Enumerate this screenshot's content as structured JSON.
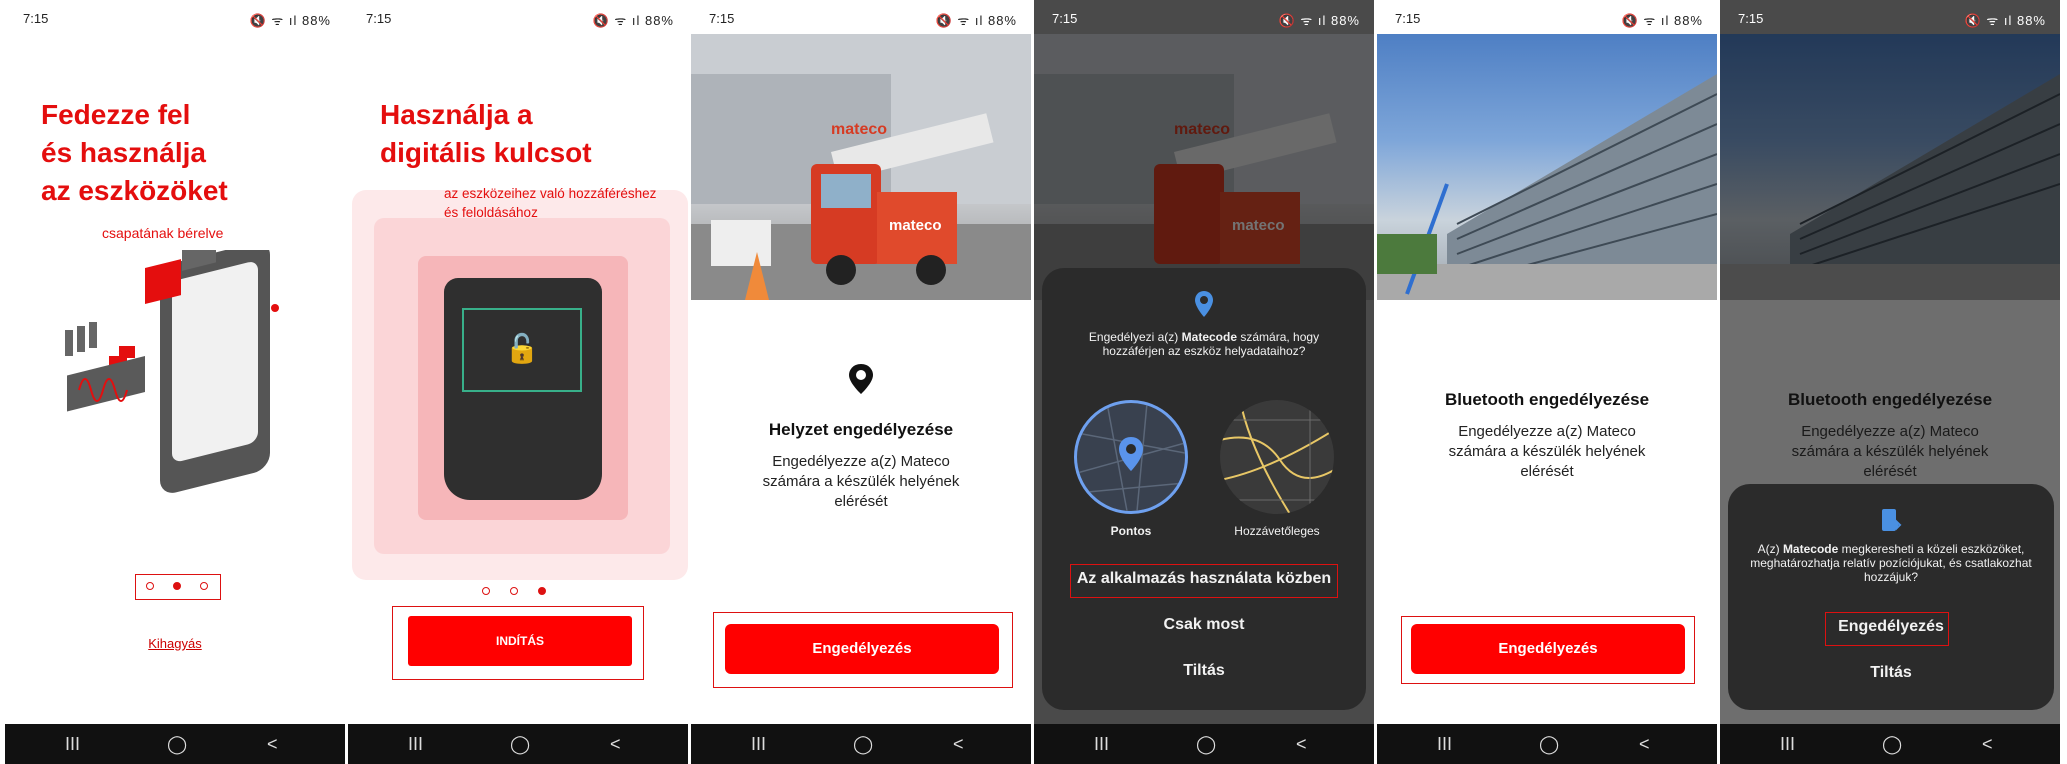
{
  "status_bar": {
    "time": "7:15",
    "icons_text": "🔇 ᯤ ıl 88%"
  },
  "nav_bar": {
    "recent": "III",
    "home": "◯",
    "back": "<"
  },
  "screen1": {
    "heading": [
      "Fedezze fel",
      "és használja",
      "az eszközöket"
    ],
    "subtitle": "csapatának bérelve",
    "skip_link": "Kihagyás"
  },
  "screen2": {
    "heading": [
      "Használja a",
      "digitális kulcsot"
    ],
    "subtitle_lines": [
      "az eszközeihez való hozzáféréshez",
      "és feloldásához"
    ],
    "start_button": "INDÍTÁS"
  },
  "screen3": {
    "title": "Helyzet engedélyezése",
    "body_lines": [
      "Engedélyezze a(z) Mateco",
      "számára a készülék helyének",
      "elérését"
    ],
    "allow_button": "Engedélyezés"
  },
  "screen4": {
    "prompt_prefix": "Engedélyezi a(z)",
    "app_name": "Matecode",
    "prompt_suffix": "számára, hogy hozzáférjen az eszköz helyadataihoz?",
    "precise_label": "Pontos",
    "approximate_label": "Hozzávetőleges",
    "option_while_using": "Az alkalmazás használata közben",
    "option_only_now": "Csak most",
    "option_deny": "Tiltás"
  },
  "screen5": {
    "title": "Bluetooth engedélyezése",
    "body_lines": [
      "Engedélyezze a(z) Mateco",
      "számára a készülék helyének",
      "elérését"
    ],
    "allow_button": "Engedélyezés"
  },
  "screen6": {
    "title": "Bluetooth engedélyezése",
    "body_lines": [
      "Engedélyezze a(z) Mateco",
      "számára a készülék helyének",
      "elérését"
    ],
    "prompt_prefix": "A(z)",
    "app_name": "Matecode",
    "prompt_suffix": "megkeresheti a közeli eszközöket, meghatározhatja relatív pozíciójukat, és csatlakozhat hozzájuk?",
    "option_allow": "Engedélyezés",
    "option_deny": "Tiltás"
  },
  "photo_truck": {
    "brand_text": "mateco"
  },
  "colors": {
    "brand_red": "#e40e0e",
    "button_red": "#ff0000",
    "sheet_dark": "#2b2b2b"
  }
}
